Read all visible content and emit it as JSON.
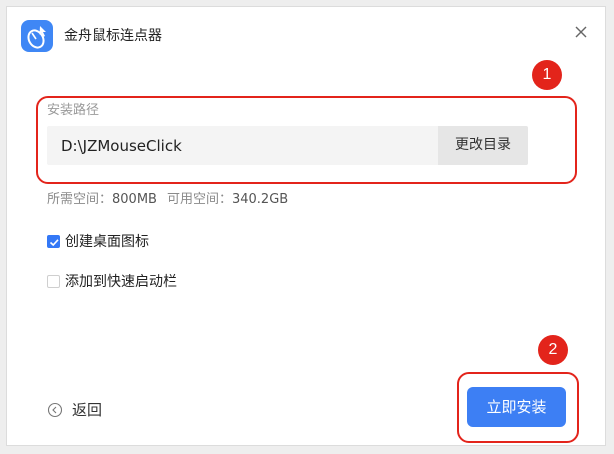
{
  "header": {
    "app_icon": "mouse-click-icon",
    "title": "金舟鼠标连点器",
    "close_icon": "close-icon"
  },
  "annotations": {
    "step1": "1",
    "step2": "2",
    "color": "#e3241b"
  },
  "install_path": {
    "label": "安装路径",
    "value": "D:\\JZMouseClick",
    "change_button": "更改目录"
  },
  "space": {
    "required_label": "所需空间：",
    "required_value": "800MB",
    "available_label": "可用空间：",
    "available_value": "340.2GB"
  },
  "options": [
    {
      "label": "创建桌面图标",
      "checked": true
    },
    {
      "label": "添加到快速启动栏",
      "checked": false
    }
  ],
  "footer": {
    "back_icon": "back-arrow-icon",
    "back_label": "返回",
    "install_button": "立即安装"
  },
  "colors": {
    "accent": "#3d7ff4",
    "checkbox": "#3478f6"
  }
}
